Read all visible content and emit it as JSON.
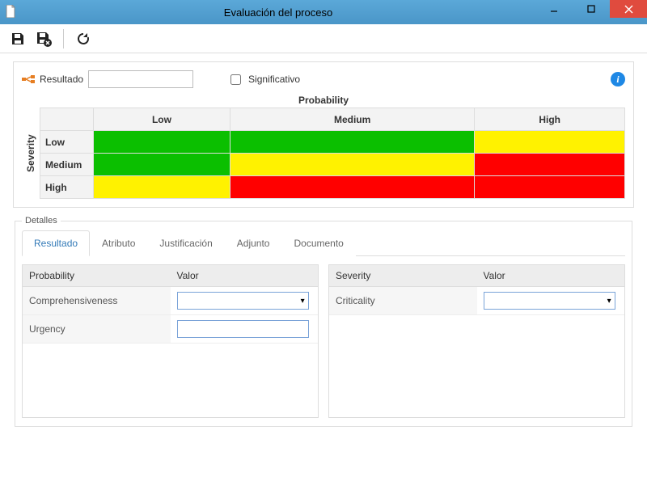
{
  "window": {
    "title": "Evaluación del proceso"
  },
  "toolbar": {
    "save_tip": "Guardar",
    "save_clear_tip": "Guardar y limpiar",
    "refresh_tip": "Refrescar"
  },
  "header": {
    "result_label": "Resultado",
    "result_value": "",
    "significant_label": "Significativo",
    "significant_checked": false
  },
  "matrix": {
    "x_title": "Probability",
    "y_title": "Severity",
    "cols": [
      "Low",
      "Medium",
      "High"
    ],
    "rows": [
      "Low",
      "Medium",
      "High"
    ],
    "cells": [
      [
        "green",
        "green",
        "yellow"
      ],
      [
        "green",
        "yellow",
        "red"
      ],
      [
        "yellow",
        "red",
        "red"
      ]
    ]
  },
  "details": {
    "legend": "Detalles",
    "tabs": [
      "Resultado",
      "Atributo",
      "Justificación",
      "Adjunto",
      "Documento"
    ],
    "active_tab": 0,
    "left": {
      "col1": "Probability",
      "col2": "Valor",
      "rows": [
        {
          "label": "Comprehensiveness",
          "editor": "combo",
          "value": ""
        },
        {
          "label": "Urgency",
          "editor": "text",
          "value": ""
        }
      ]
    },
    "right": {
      "col1": "Severity",
      "col2": "Valor",
      "rows": [
        {
          "label": "Criticality",
          "editor": "combo",
          "value": ""
        }
      ]
    }
  }
}
